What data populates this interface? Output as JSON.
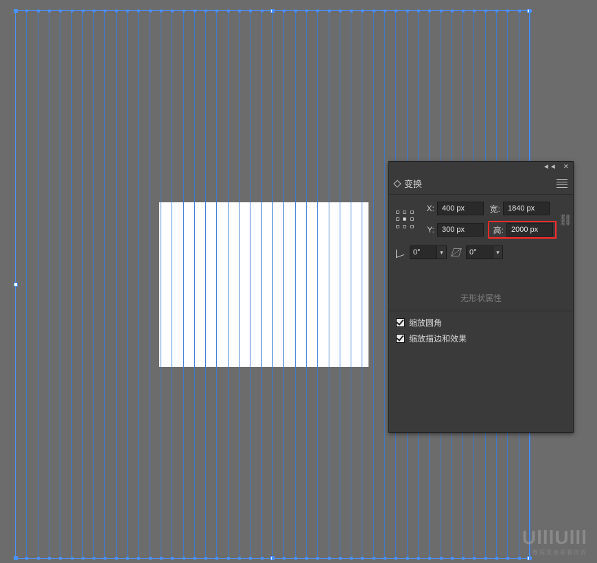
{
  "panel": {
    "title": "变换",
    "x_label": "X:",
    "y_label": "Y:",
    "w_label": "宽:",
    "h_label": "高:",
    "x_value": "400 px",
    "y_value": "300 px",
    "w_value": "1840 px",
    "h_value": "2000 px",
    "rotate_label": "⊿:",
    "rotate_value": "0°",
    "shear_value": "0°",
    "no_shape": "无形状属性",
    "scale_corners_label": "缩放圆角",
    "scale_strokes_label": "缩放描边和效果",
    "scale_corners_checked": true,
    "scale_strokes_checked": true
  },
  "watermark": {
    "logo": "UlllUlll",
    "sub": "教程灵感就看优优"
  },
  "selection": {
    "guide_count": 47
  }
}
